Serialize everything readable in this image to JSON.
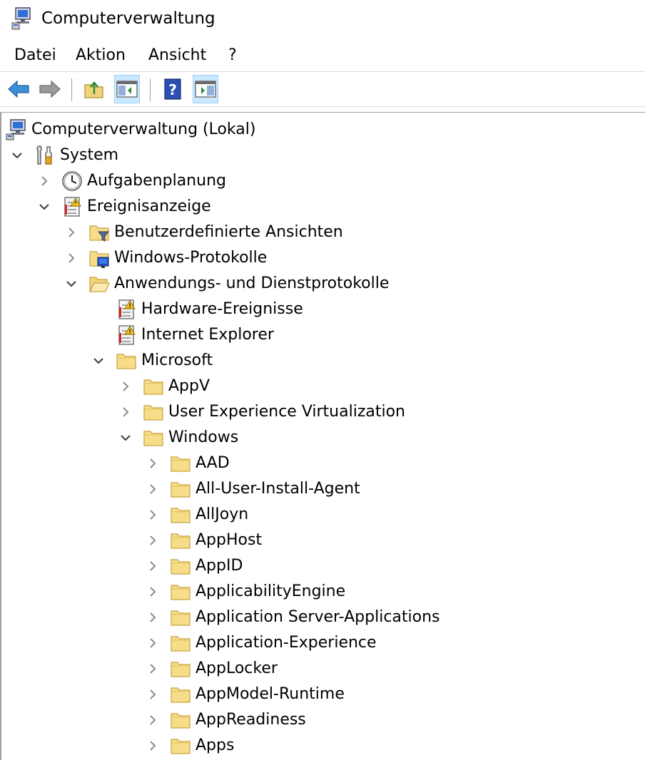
{
  "window": {
    "title": "Computerverwaltung",
    "icon": "computer-management-icon"
  },
  "menu": {
    "items": [
      "Datei",
      "Aktion",
      "Ansicht",
      "?"
    ]
  },
  "toolbar": {
    "buttons": [
      {
        "name": "back-button",
        "icon": "back-arrow-icon"
      },
      {
        "name": "forward-button",
        "icon": "forward-arrow-icon"
      },
      {
        "name": "up-folder-button",
        "icon": "up-folder-icon"
      },
      {
        "name": "show-hide-console-tree-button",
        "icon": "console-tree-icon",
        "checked": true
      },
      {
        "name": "help-button",
        "icon": "help-icon"
      },
      {
        "name": "show-hide-action-pane-button",
        "icon": "action-pane-icon",
        "checked": true
      }
    ]
  },
  "tree": {
    "nodes": [
      {
        "label": "Computerverwaltung (Lokal)",
        "level": 0,
        "expander": "none",
        "icon": "computer-icon"
      },
      {
        "label": "System",
        "level": 0,
        "expander": "expanded",
        "icon": "tools-icon"
      },
      {
        "label": "Aufgabenplanung",
        "level": 1,
        "expander": "collapsed",
        "icon": "clock-icon"
      },
      {
        "label": "Ereignisanzeige",
        "level": 1,
        "expander": "expanded",
        "icon": "event-viewer-icon"
      },
      {
        "label": "Benutzerdefinierte Ansichten",
        "level": 2,
        "expander": "collapsed",
        "icon": "filter-folder-icon"
      },
      {
        "label": "Windows-Protokolle",
        "level": 2,
        "expander": "collapsed",
        "icon": "windows-folder-icon"
      },
      {
        "label": "Anwendungs- und Dienstprotokolle",
        "level": 2,
        "expander": "expanded",
        "icon": "folder-open-icon"
      },
      {
        "label": "Hardware-Ereignisse",
        "level": 3,
        "expander": "none",
        "icon": "event-log-icon"
      },
      {
        "label": "Internet Explorer",
        "level": 3,
        "expander": "none",
        "icon": "event-log-icon"
      },
      {
        "label": "Microsoft",
        "level": 3,
        "expander": "expanded",
        "icon": "folder-icon"
      },
      {
        "label": "AppV",
        "level": 4,
        "expander": "collapsed",
        "icon": "folder-icon"
      },
      {
        "label": "User Experience Virtualization",
        "level": 4,
        "expander": "collapsed",
        "icon": "folder-icon"
      },
      {
        "label": "Windows",
        "level": 4,
        "expander": "expanded",
        "icon": "folder-icon"
      },
      {
        "label": "AAD",
        "level": 5,
        "expander": "collapsed",
        "icon": "folder-icon"
      },
      {
        "label": "All-User-Install-Agent",
        "level": 5,
        "expander": "collapsed",
        "icon": "folder-icon"
      },
      {
        "label": "AllJoyn",
        "level": 5,
        "expander": "collapsed",
        "icon": "folder-icon"
      },
      {
        "label": "AppHost",
        "level": 5,
        "expander": "collapsed",
        "icon": "folder-icon"
      },
      {
        "label": "AppID",
        "level": 5,
        "expander": "collapsed",
        "icon": "folder-icon"
      },
      {
        "label": "ApplicabilityEngine",
        "level": 5,
        "expander": "collapsed",
        "icon": "folder-icon"
      },
      {
        "label": "Application Server-Applications",
        "level": 5,
        "expander": "collapsed",
        "icon": "folder-icon"
      },
      {
        "label": "Application-Experience",
        "level": 5,
        "expander": "collapsed",
        "icon": "folder-icon"
      },
      {
        "label": "AppLocker",
        "level": 5,
        "expander": "collapsed",
        "icon": "folder-icon"
      },
      {
        "label": "AppModel-Runtime",
        "level": 5,
        "expander": "collapsed",
        "icon": "folder-icon"
      },
      {
        "label": "AppReadiness",
        "level": 5,
        "expander": "collapsed",
        "icon": "folder-icon"
      },
      {
        "label": "Apps",
        "level": 5,
        "expander": "collapsed",
        "icon": "folder-icon"
      }
    ]
  }
}
